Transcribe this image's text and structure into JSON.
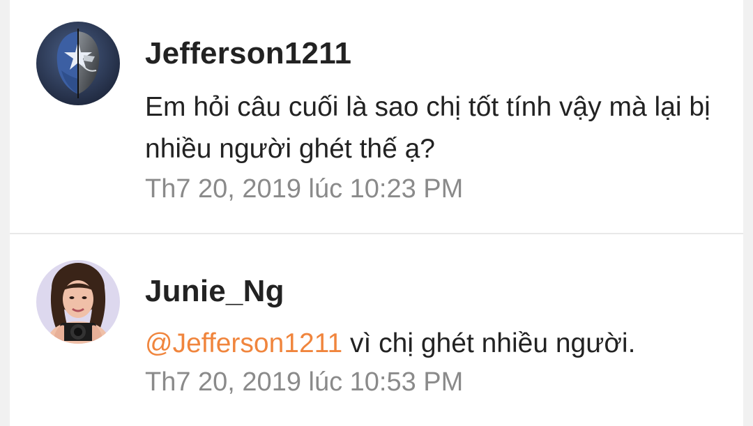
{
  "comments": [
    {
      "username": "Jefferson1211",
      "avatar_icon": "masked-hero-avatar",
      "text": "Em hỏi câu cuối là sao chị tốt tính vậy mà lại bị nhiều người ghét thế ạ?",
      "timestamp": "Th7 20, 2019 lúc 10:23 PM"
    },
    {
      "username": "Junie_Ng",
      "avatar_icon": "woman-with-camera-avatar",
      "mention": "@Jefferson1211",
      "text": " vì chị ghét nhiều người.",
      "timestamp": "Th7 20, 2019 lúc 10:53 PM"
    }
  ],
  "colors": {
    "mention": "#f0853d",
    "username": "#222222",
    "timestamp": "#8a8a8a",
    "background": "#f1f1f1"
  }
}
